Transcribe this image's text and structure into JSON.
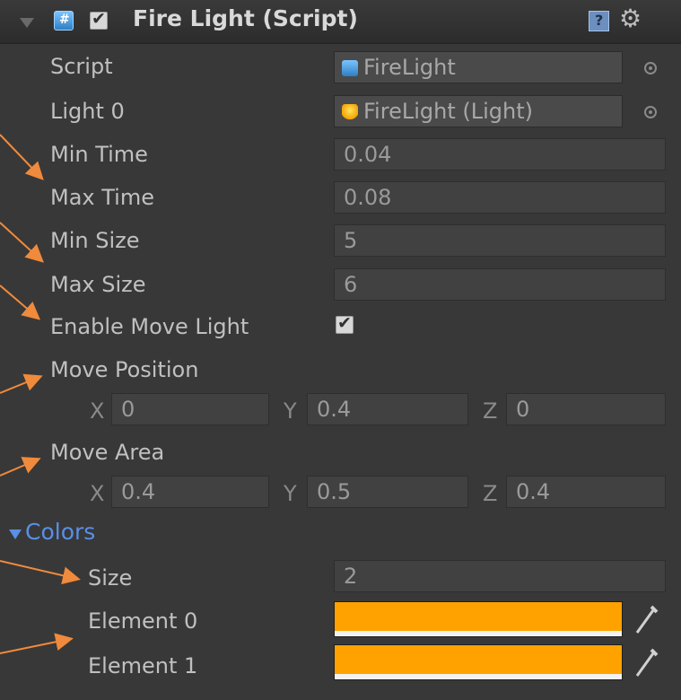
{
  "component": {
    "title": "Fire Light (Script)",
    "enabled": true,
    "icons": {
      "header": "script-icon",
      "help": "help-icon",
      "settings": "gear-icon"
    }
  },
  "fields": {
    "script": {
      "label": "Script",
      "value": "FireLight"
    },
    "light0": {
      "label": "Light 0",
      "value": "FireLight (Light)"
    },
    "min_time": {
      "label": "Min Time",
      "value": "0.04"
    },
    "max_time": {
      "label": "Max Time",
      "value": "0.08"
    },
    "min_size": {
      "label": "Min Size",
      "value": "5"
    },
    "max_size": {
      "label": "Max Size",
      "value": "6"
    },
    "enable_move_light": {
      "label": "Enable Move Light",
      "checked": true
    },
    "move_position": {
      "label": "Move Position",
      "x_label": "X",
      "x": "0",
      "y_label": "Y",
      "y": "0.4",
      "z_label": "Z",
      "z": "0"
    },
    "move_area": {
      "label": "Move Area",
      "x_label": "X",
      "x": "0.4",
      "y_label": "Y",
      "y": "0.5",
      "z_label": "Z",
      "z": "0.4"
    }
  },
  "colors": {
    "label": "Colors",
    "expanded": true,
    "size_label": "Size",
    "size": "2",
    "elements": [
      {
        "label": "Element 0",
        "color": "#ffa200"
      },
      {
        "label": "Element 1",
        "color": "#ffa200"
      }
    ]
  },
  "annotation_color": "#f08a3c"
}
